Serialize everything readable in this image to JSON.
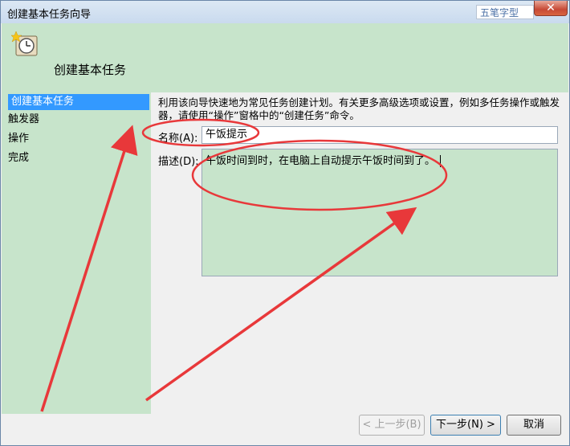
{
  "window": {
    "title": "创建基本任务向导"
  },
  "watermark": {
    "text": "五笔字型"
  },
  "titlebar": {
    "close_symbol": "✕"
  },
  "header": {
    "title": "创建基本任务",
    "icon": "clock-icon"
  },
  "nav": {
    "items": [
      {
        "label": "创建基本任务",
        "selected": true
      },
      {
        "label": "触发器",
        "selected": false
      },
      {
        "label": "操作",
        "selected": false
      },
      {
        "label": "完成",
        "selected": false
      }
    ]
  },
  "main": {
    "description": "利用该向导快速地为常见任务创建计划。有关更多高级选项或设置，例如多任务操作或触发器，请使用“操作”窗格中的“创建任务”命令。",
    "name_label": "名称(A):",
    "name_value": "午饭提示",
    "desc_label": "描述(D):",
    "desc_value": "午饭时间到时，在电脑上自动提示午饭时间到了。"
  },
  "buttons": {
    "back": "< 上一步(B)",
    "next": "下一步(N) >",
    "cancel": "取消"
  },
  "annotation_color": "#e8383a"
}
